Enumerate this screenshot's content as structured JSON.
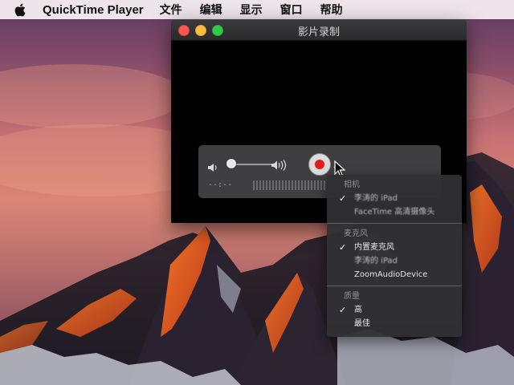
{
  "menubar": {
    "app_name": "QuickTime Player",
    "items": [
      "文件",
      "编辑",
      "显示",
      "窗口",
      "帮助"
    ]
  },
  "window": {
    "title": "影片录制",
    "time_readout": "--:--"
  },
  "dropdown": {
    "sections": [
      {
        "header": "相机",
        "items": [
          {
            "label": "李涛的 iPad",
            "checked": true
          },
          {
            "label": "FaceTime 高清摄像头",
            "checked": false
          }
        ]
      },
      {
        "header": "麦克风",
        "items": [
          {
            "label": "内置麦克风",
            "checked": true
          },
          {
            "label": "李涛的 iPad",
            "checked": false
          },
          {
            "label": "ZoomAudioDevice",
            "checked": false
          }
        ]
      },
      {
        "header": "质量",
        "items": [
          {
            "label": "高",
            "checked": true
          },
          {
            "label": "最佳",
            "checked": false
          }
        ]
      }
    ]
  },
  "colors": {
    "record_red": "#e41c1c",
    "traffic_close": "#fc5753",
    "traffic_min": "#fdbc40",
    "traffic_max": "#34c84a"
  },
  "volume_level": 0.0
}
